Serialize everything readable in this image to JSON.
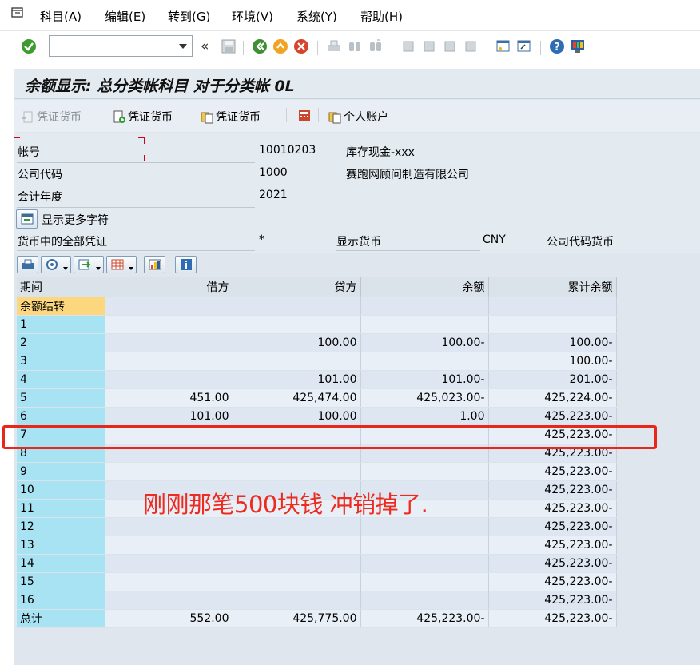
{
  "menu": {
    "items": [
      {
        "label": "科目(A)"
      },
      {
        "label": "编辑(E)"
      },
      {
        "label": "转到(G)"
      },
      {
        "label": "环境(V)"
      },
      {
        "label": "系统(Y)"
      },
      {
        "label": "帮助(H)"
      }
    ]
  },
  "toolbar": {
    "command_value": "",
    "back_symbol": "«"
  },
  "title": "余额显示: 总分类帐科目 对于分类帐 0L",
  "app_toolbar": {
    "btn1": "凭证货币",
    "btn2": "凭证货币",
    "btn3": "凭证货币",
    "btn4": "个人账户"
  },
  "header": {
    "account_label": "帐号",
    "account_value": "10010203",
    "account_desc": "库存现金-xxx",
    "company_label": "公司代码",
    "company_value": "1000",
    "company_desc": "赛跑网顾问制造有限公司",
    "year_label": "会计年度",
    "year_value": "2021",
    "more_chars_label": "显示更多字符",
    "all_docs_label": "货币中的全部凭证",
    "all_docs_value": "*",
    "display_currency_label": "显示货币",
    "display_currency_value": "CNY",
    "company_currency_label": "公司代码货币"
  },
  "grid": {
    "columns": [
      "期间",
      "借方",
      "贷方",
      "余额",
      "累计余额"
    ],
    "rows": [
      [
        "余额结转",
        "",
        "",
        "",
        ""
      ],
      [
        "1",
        "",
        "",
        "",
        ""
      ],
      [
        "2",
        "",
        "100.00",
        "100.00-",
        "100.00-"
      ],
      [
        "3",
        "",
        "",
        "",
        "100.00-"
      ],
      [
        "4",
        "",
        "101.00",
        "101.00-",
        "201.00-"
      ],
      [
        "5",
        "451.00",
        "425,474.00",
        "425,023.00-",
        "425,224.00-"
      ],
      [
        "6",
        "101.00",
        "100.00",
        "1.00",
        "425,223.00-"
      ],
      [
        "7",
        "",
        "",
        "",
        "425,223.00-"
      ],
      [
        "8",
        "",
        "",
        "",
        "425,223.00-"
      ],
      [
        "9",
        "",
        "",
        "",
        "425,223.00-"
      ],
      [
        "10",
        "",
        "",
        "",
        "425,223.00-"
      ],
      [
        "11",
        "",
        "",
        "",
        "425,223.00-"
      ],
      [
        "12",
        "",
        "",
        "",
        "425,223.00-"
      ],
      [
        "13",
        "",
        "",
        "",
        "425,223.00-"
      ],
      [
        "14",
        "",
        "",
        "",
        "425,223.00-"
      ],
      [
        "15",
        "",
        "",
        "",
        "425,223.00-"
      ],
      [
        "16",
        "",
        "",
        "",
        "425,223.00-"
      ],
      [
        "总计",
        "552.00",
        "425,775.00",
        "425,223.00-",
        "425,223.00-"
      ]
    ]
  },
  "annotation": "刚刚那笔500块钱  冲销掉了.",
  "colors": {
    "annotation": "#ee2b20",
    "key_column": "#a7e3f2",
    "selected_key": "#fcd77e"
  }
}
